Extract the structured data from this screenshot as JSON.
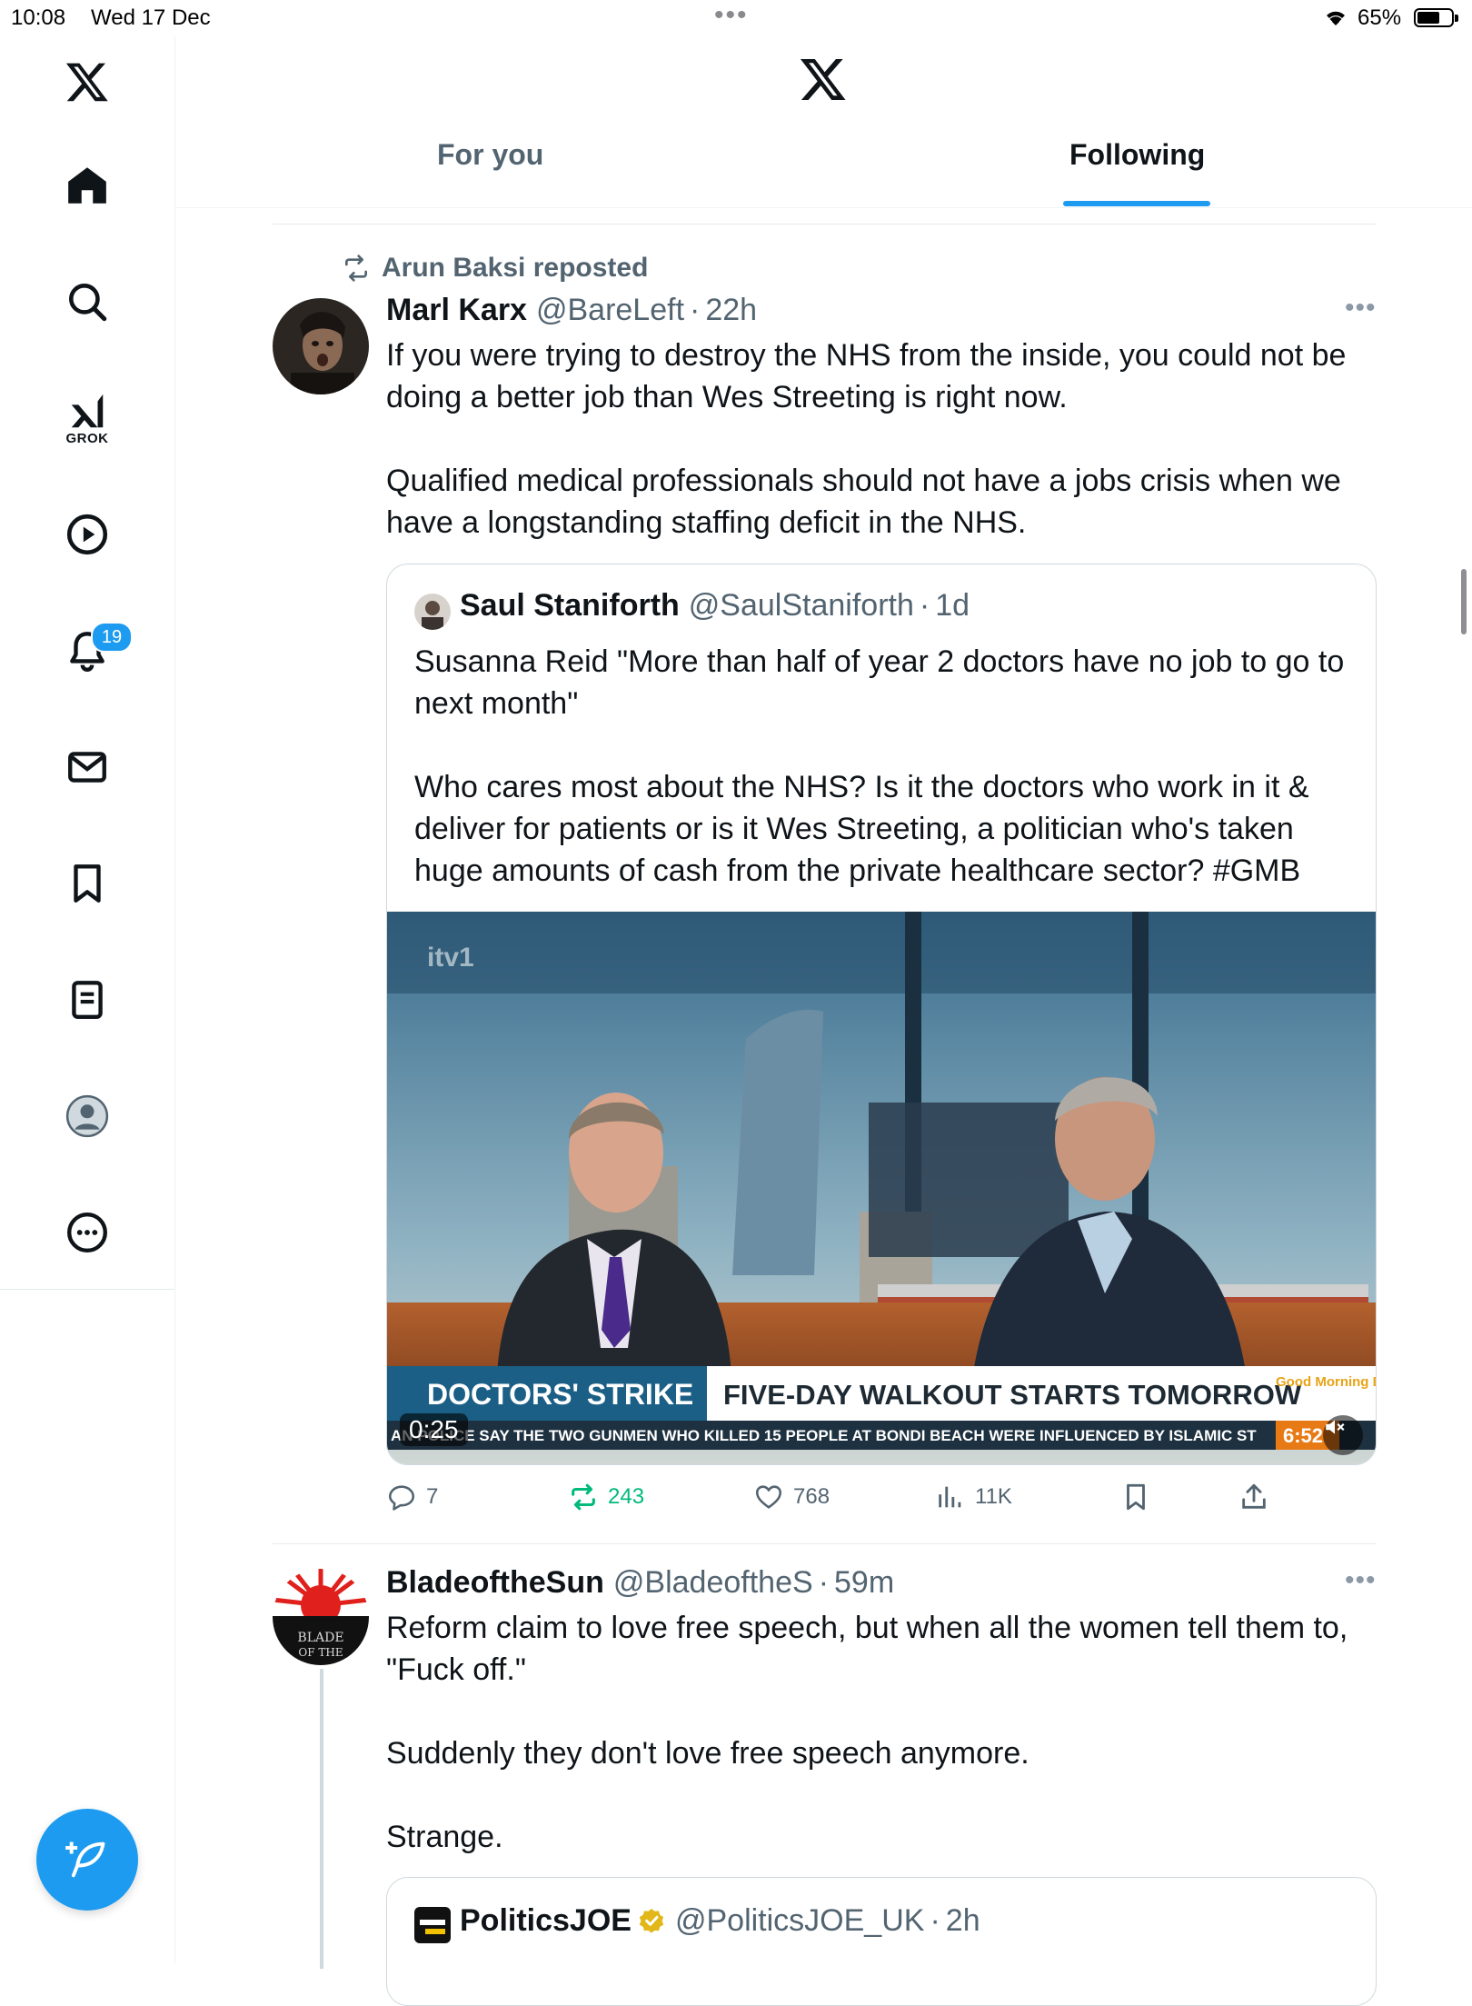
{
  "status_bar": {
    "time": "10:08",
    "date": "Wed 17 Dec",
    "battery": "65%"
  },
  "sidebar": {
    "grok_label": "GROK",
    "notifications_badge": "19"
  },
  "header": {
    "tabs": [
      {
        "label": "For you",
        "selected": false
      },
      {
        "label": "Following",
        "selected": true
      }
    ]
  },
  "tweets": [
    {
      "reposted_by": "Arun Baksi reposted",
      "name": "Marl Karx",
      "handle": "@BareLeft",
      "time": "22h",
      "text": "If you were trying to destroy the NHS from the inside, you could not be doing a better job than Wes Streeting is right now.\n\nQualified medical professionals should not have a jobs crisis when we have a longstanding staffing deficit in the NHS.",
      "quote": {
        "name": "Saul Staniforth",
        "handle": "@SaulStaniforth",
        "time": "1d",
        "text": "Susanna Reid \"More than half of year 2 doctors have no job to go to next month\"\n\nWho cares most about the NHS? Is it the doctors who work in it & deliver for patients or is it Wes Streeting, a politician who's taken huge amounts of cash from the private healthcare sector? #GMB",
        "video": {
          "duration": "0:25",
          "channel_logo": "itv1",
          "banner_left": "DOCTORS' STRIKE",
          "banner_right": "FIVE-DAY WALKOUT STARTS TOMORROW",
          "show_logo": "Good Morning Britain",
          "ticker": "AN POLICE SAY THE TWO GUNMEN WHO KILLED 15 PEOPLE AT BONDI BEACH WERE INFLUENCED BY ISLAMIC ST",
          "clock": "6:52"
        }
      },
      "actions": {
        "replies": "7",
        "reposts": "243",
        "likes": "768",
        "views": "11K"
      }
    },
    {
      "name": "BladeoftheSun",
      "handle": "@BladeoftheS",
      "time": "59m",
      "text": "Reform claim to love free speech, but when all the women tell them to, \"Fuck off.\"\n\nSuddenly they don't love free speech anymore.\n\nStrange.",
      "quote": {
        "name": "PoliticsJOE",
        "handle": "@PoliticsJOE_UK",
        "time": "2h"
      }
    }
  ],
  "colors": {
    "accent": "#1d9bf0",
    "repost_green": "#00ba7c",
    "secondary_text": "#536471"
  }
}
